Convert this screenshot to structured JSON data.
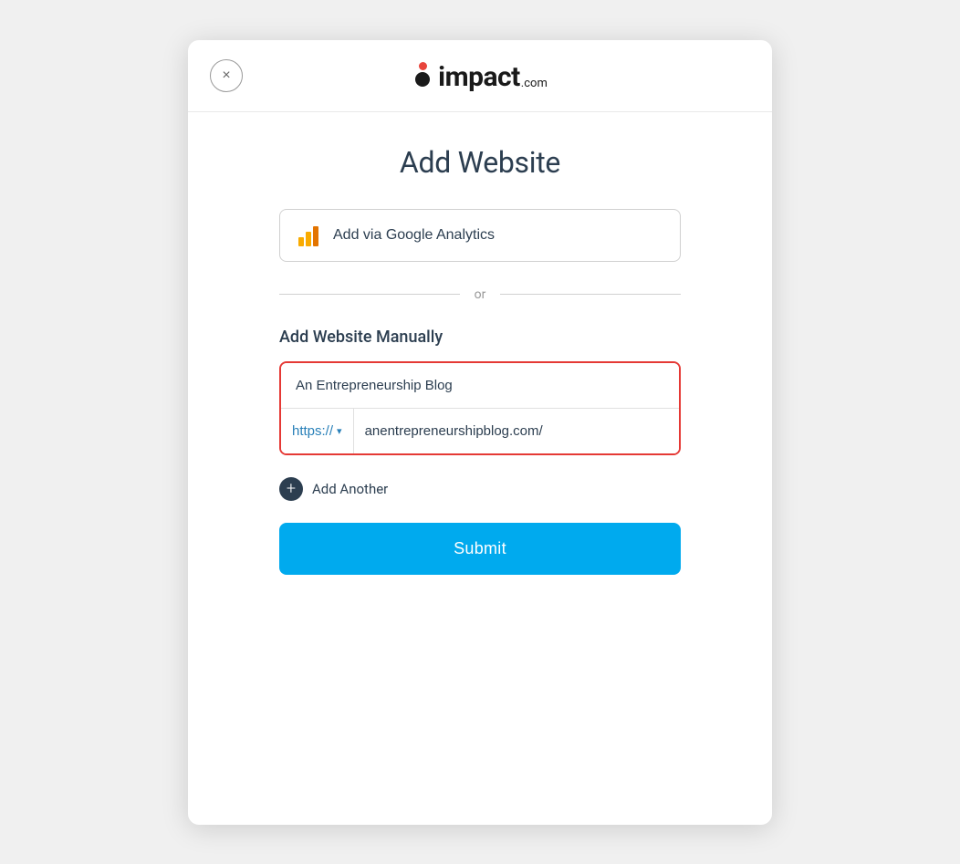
{
  "modal": {
    "close_label": "×",
    "logo": {
      "text": "impact",
      "com": ".com"
    },
    "title": "Add Website",
    "google_analytics_btn": "Add via Google Analytics",
    "divider_text": "or",
    "manual_section_title": "Add Website Manually",
    "website_name_placeholder": "An Entrepreneurship Blog",
    "website_name_value": "An Entrepreneurship Blog",
    "protocol_label": "https://",
    "url_value": "anentrepreneurshipblog.com/",
    "add_another_label": "Add Another",
    "submit_label": "Submit"
  }
}
